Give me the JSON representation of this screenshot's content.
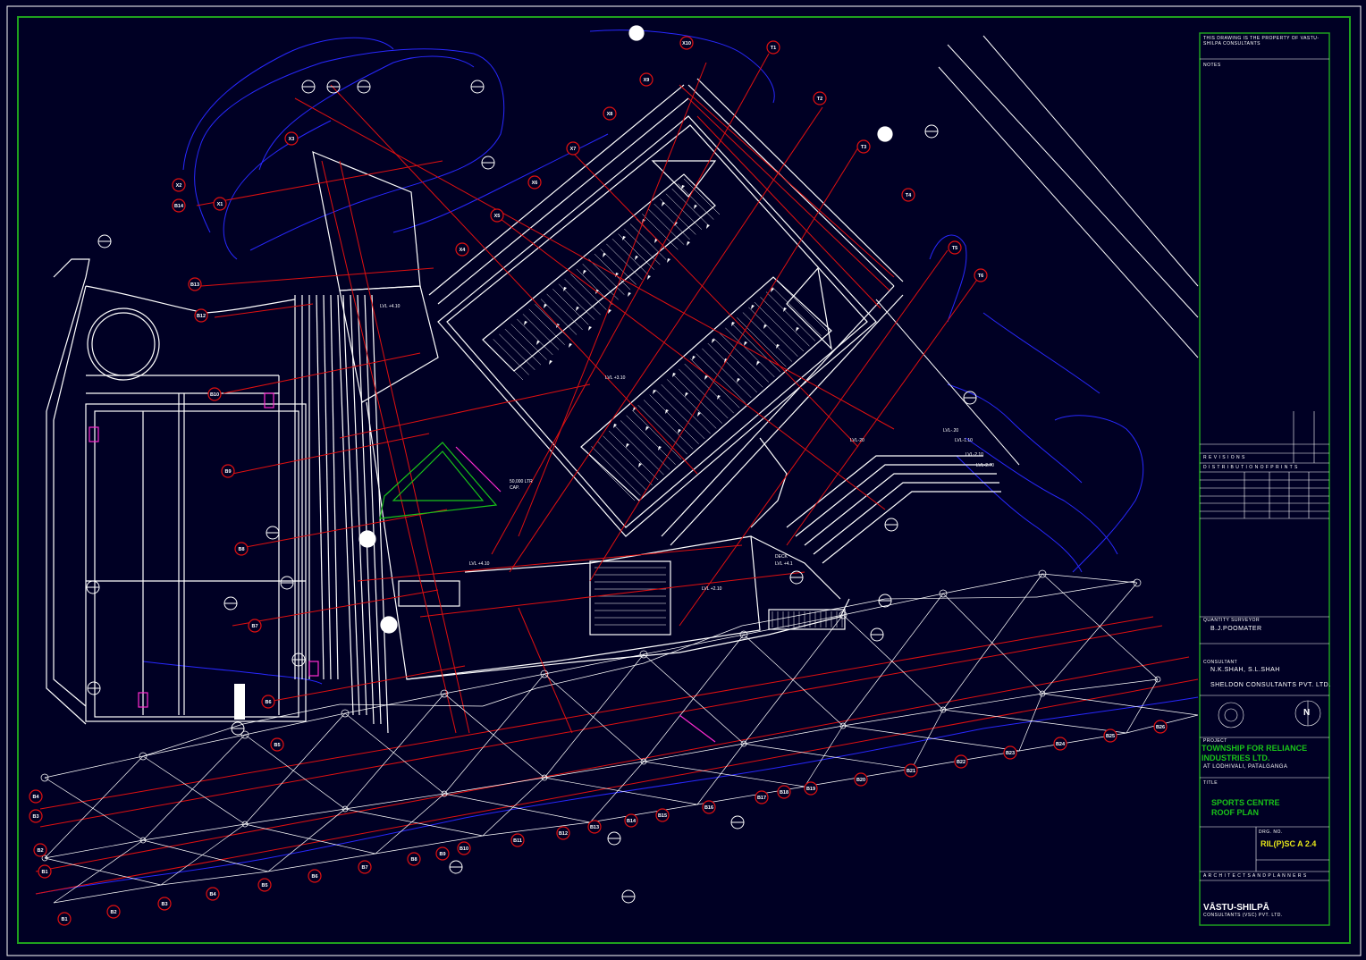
{
  "colors": {
    "background": "#000024",
    "frame": "#1ea01e",
    "lines": "#ffffff",
    "gridlines": "#e01010",
    "contours": "#2828ff",
    "accent_green": "#19c319",
    "magenta": "#ff2bd0"
  },
  "levels": [
    "LVL +4.10",
    "LVL +3.10",
    "LVL +4.10",
    "LVL +2.10",
    "LVL-.20",
    "LVL-1.10",
    "LVL-2.10",
    "LVL-2.70",
    "DECK",
    "LVL +4.1",
    "LVL-20"
  ],
  "tank_label": [
    "50,000 LTR",
    "CAP."
  ],
  "row_markers": [
    "B1",
    "B2",
    "B3",
    "B4",
    "B5",
    "B6",
    "B7",
    "B8",
    "B9",
    "B10",
    "B11",
    "B12",
    "B13",
    "B14",
    "B15",
    "B16",
    "B17",
    "B18",
    "B19",
    "B20",
    "B21",
    "B22",
    "B23",
    "B24",
    "B25",
    "B26"
  ],
  "x_markers": [
    "X1",
    "X2",
    "X3",
    "X4",
    "X5",
    "X6",
    "X7",
    "X8",
    "X9",
    "X10"
  ],
  "t_markers": [
    "T1",
    "T2",
    "T3",
    "T4",
    "T5",
    "T6"
  ],
  "title_block": {
    "top_note": "THIS DRAWING IS THE PROPERTY OF VASTU-SHILPA CONSULTANTS",
    "notes_label": "NOTES",
    "revisions_label": "R E V I S I O N S",
    "distribution_label": "D I S T R I B U T I O N  O F  P R I N T S",
    "quantity_surveyor_label": "QUANTITY SURVEYOR",
    "quantity_surveyor": "B.J.POOMATER",
    "consultant_label": "CONSULTANT",
    "consultant_1": "N.K.SHAH, S.L.SHAH",
    "consultant_2": "SHELDON CONSULTANTS PVT. LTD.",
    "project_label": "PROJECT",
    "project": "TOWNSHIP FOR RELIANCE INDUSTRIES LTD.",
    "location": "AT LODHIVALI, PATALGANGA",
    "title_label": "TITLE",
    "title_line1": "SPORTS CENTRE",
    "title_line2": "ROOF PLAN",
    "drg_no_label": "DRG. NO.",
    "drg_no": "RIL(P)SC A 2.4",
    "architects_label": "A R C H I T E C T S   A N D   P L A N N E R S",
    "firm": "VĀSTU-SHILPĀ",
    "firm_sub": "CONSULTANTS (VSC) PVT. LTD.",
    "north": "N"
  }
}
